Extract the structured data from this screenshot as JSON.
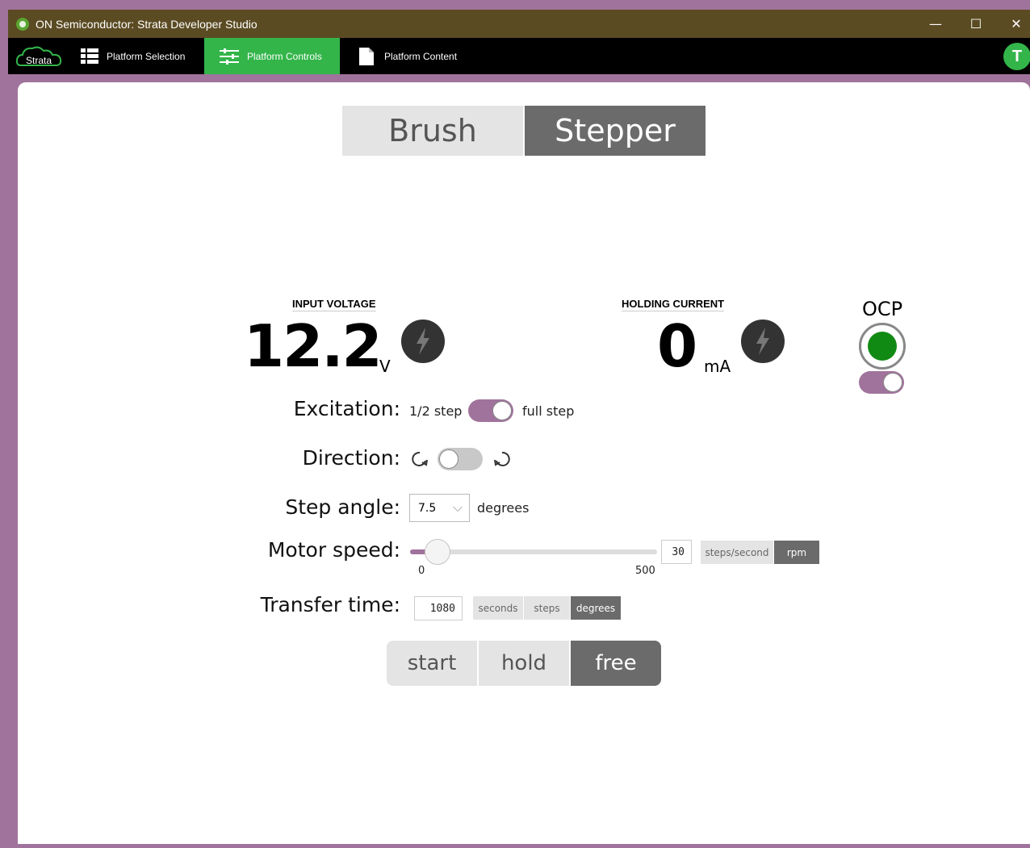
{
  "window": {
    "title": "ON Semiconductor: Strata Developer Studio",
    "controls": {
      "minimize": "—",
      "maximize": "☐",
      "close": "✕"
    }
  },
  "navbar": {
    "logo_text": "Strata",
    "items": [
      {
        "label": "Platform Selection",
        "icon": "grid-list-icon",
        "active": false
      },
      {
        "label": "Platform Controls",
        "icon": "sliders-icon",
        "active": true
      },
      {
        "label": "Platform Content",
        "icon": "document-icon",
        "active": false
      }
    ],
    "user_initial": "T",
    "accent": "#33b54a"
  },
  "motor_type": {
    "options": [
      "Brush",
      "Stepper"
    ],
    "selected": "Stepper"
  },
  "input_voltage": {
    "label": "INPUT VOLTAGE",
    "value": "12.2",
    "unit": "V"
  },
  "holding_current": {
    "label": "HOLDING CURRENT",
    "value": "0",
    "unit": "mA"
  },
  "ocp": {
    "label": "OCP",
    "indicator_color": "#118a13",
    "toggle_on": true
  },
  "excitation": {
    "label": "Excitation:",
    "left": "1/2 step",
    "right": "full step",
    "toggle_on": true
  },
  "direction": {
    "label": "Direction:",
    "left_icon": "rotate-clockwise-icon",
    "right_icon": "rotate-counterclockwise-icon",
    "toggle_on": false
  },
  "step_angle": {
    "label": "Step angle:",
    "value": "7.5",
    "unit": "degrees"
  },
  "motor_speed": {
    "label": "Motor speed:",
    "min": "0",
    "max": "500",
    "value": "30",
    "fraction": 0.06,
    "units": [
      "steps/second",
      "rpm"
    ],
    "selected_unit": "rpm"
  },
  "transfer_time": {
    "label": "Transfer time:",
    "value": "1080",
    "units": [
      "seconds",
      "steps",
      "degrees"
    ],
    "selected_unit": "degrees"
  },
  "actions": {
    "buttons": [
      "start",
      "hold",
      "free"
    ],
    "selected": "free"
  },
  "colors": {
    "toggle_on": "#a0739c",
    "selected_button": "#6b6b6b",
    "titlebar": "#5b4b23"
  }
}
